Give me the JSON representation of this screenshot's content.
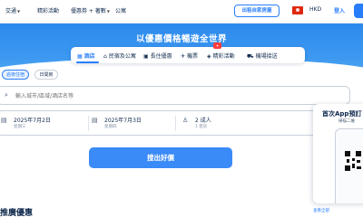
{
  "topnav": {
    "items": [
      {
        "label": "交通",
        "has_chevron": true
      },
      {
        "label": "精彩活動",
        "has_chevron": false
      },
      {
        "label": "優惠券 + 著數",
        "has_chevron": true
      },
      {
        "label": "公寓",
        "has_chevron": false
      }
    ],
    "list_property_label": "出租自家房屋",
    "currency": "HKD",
    "login_label": "登入"
  },
  "hero": {
    "title": "以優惠價格暢遊全世界"
  },
  "tabs": [
    {
      "label": "酒店",
      "icon": "hotel-icon",
      "active": true
    },
    {
      "label": "民宿及公寓",
      "icon": "home-icon",
      "active": false
    },
    {
      "label": "長住優惠",
      "icon": "calendar-icon",
      "active": false
    },
    {
      "label": "機票",
      "icon": "plane-icon",
      "active": false
    },
    {
      "label": "精彩活動",
      "icon": "ticket-icon",
      "active": false
    },
    {
      "label": "機場接送",
      "icon": "car-icon",
      "active": false
    }
  ],
  "trip_types": [
    {
      "label": "過夜住宿",
      "active": true
    },
    {
      "label": "日間房",
      "active": false
    }
  ],
  "destination": {
    "placeholder": "輸入城市/區域/酒店名等"
  },
  "checkin": {
    "date": "2025年7月2日",
    "weekday": "星期三"
  },
  "checkout": {
    "date": "2025年7月3日",
    "weekday": "星期四"
  },
  "guests": {
    "adults": "2 成人",
    "rooms": "1 客房"
  },
  "search_button_label": "搜出好價",
  "section": {
    "title": "推廣優惠",
    "more_link": "查看全部"
  },
  "promo": {
    "title": "首次App預訂",
    "subtitle": "掃描二維"
  },
  "colors": {
    "accent": "#287dfa",
    "hero_top": "#2d8aed",
    "search_button": "#3a8bf7",
    "text": "#0f294d"
  }
}
